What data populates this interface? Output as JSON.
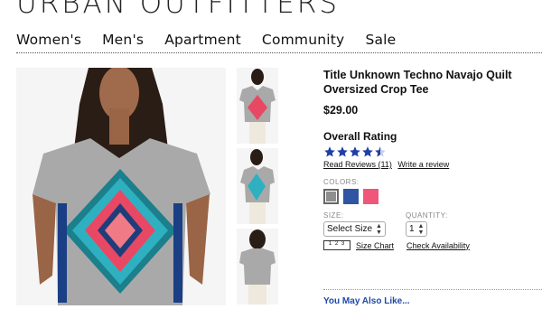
{
  "brand": {
    "name": "URBAN OUTFITTERS"
  },
  "nav": [
    {
      "label": "Women's"
    },
    {
      "label": "Men's"
    },
    {
      "label": "Apartment"
    },
    {
      "label": "Community"
    },
    {
      "label": "Sale"
    }
  ],
  "product": {
    "title": "Title Unknown Techno Navajo Quilt Oversized Crop Tee",
    "price": "$29.00",
    "rating_label": "Overall Rating",
    "rating_stars": 4.5,
    "read_reviews": "Read Reviews (11)",
    "write_review": "Write a review",
    "colors_label": "COLORS:",
    "colors": [
      "#8f8f8f",
      "#2f55a3",
      "#f0567a"
    ],
    "size_label": "SIZE:",
    "size_value": "Select Size",
    "quantity_label": "QUANTITY:",
    "quantity_value": "1",
    "size_chart": "Size Chart",
    "check_availability": "Check Availability",
    "ruler_text": "1 2 3"
  },
  "also": {
    "label": "You May Also Like..."
  }
}
